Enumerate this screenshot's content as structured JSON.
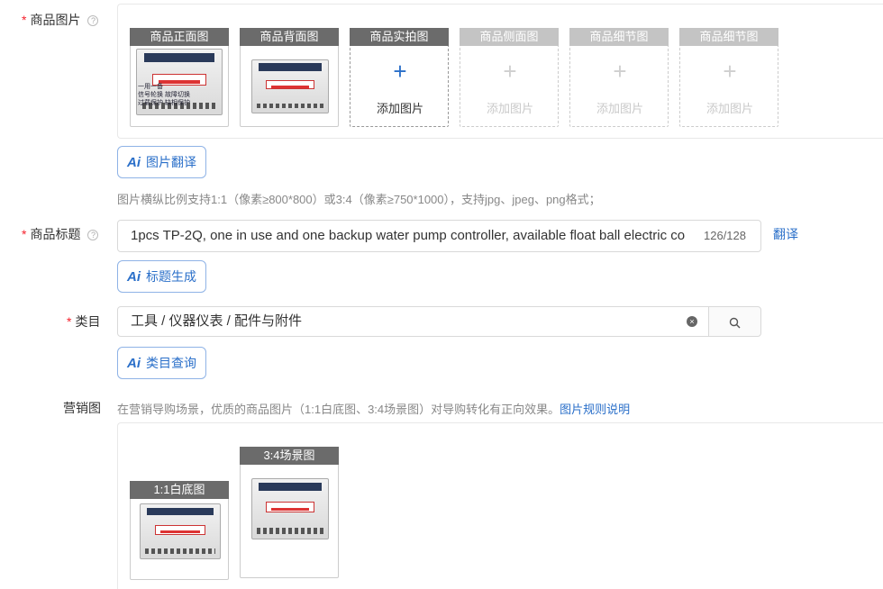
{
  "product_images": {
    "label": "商品图片",
    "help": "?",
    "slots": [
      {
        "caption": "商品正面图",
        "add_text": ""
      },
      {
        "caption": "商品背面图",
        "add_text": ""
      },
      {
        "caption": "商品实拍图",
        "add_icon": "+",
        "add_text": "添加图片"
      },
      {
        "caption": "商品侧面图",
        "add_icon": "+",
        "add_text": "添加图片"
      },
      {
        "caption": "商品细节图",
        "add_icon": "+",
        "add_text": "添加图片"
      },
      {
        "caption": "商品细节图",
        "add_icon": "+",
        "add_text": "添加图片"
      }
    ],
    "front_image_lines": [
      "TP-2Q水泵控制器",
      "WhatsApp",
      "+8615974057356",
      "一用一备",
      "信号轮换  故障切换",
      "过载保护  缺相保护"
    ],
    "translate_button": "图片翻译",
    "hint": "图片横纵比例支持1:1（像素≥800*800）或3:4（像素≥750*1000），支持jpg、jpeg、png格式；"
  },
  "title_field": {
    "label": "商品标题",
    "help": "?",
    "value": "1pcs TP-2Q, one in use and one backup water pump controller, available float ball electric co",
    "counter": "126/128",
    "translate_link": "翻译",
    "generate_button": "标题生成"
  },
  "category_field": {
    "label": "类目",
    "value": "工具 / 仪器仪表 / 配件与附件",
    "clear_icon": "×",
    "query_button": "类目查询"
  },
  "marketing": {
    "label": "营销图",
    "hint": "在营销导购场景，优质的商品图片（1:1白底图、3:4场景图）对导购转化有正向效果。",
    "rules_link": "图片规则说明",
    "slot_captions": [
      "1:1白底图",
      "3:4场景图"
    ]
  },
  "ai_icon": "Ai",
  "required_mark": "*",
  "colors": {
    "accent": "#2a6fc9",
    "required": "#f5222d",
    "caption_bg": "#6b6b6b",
    "caption_disabled_bg": "#c4c4c4"
  }
}
